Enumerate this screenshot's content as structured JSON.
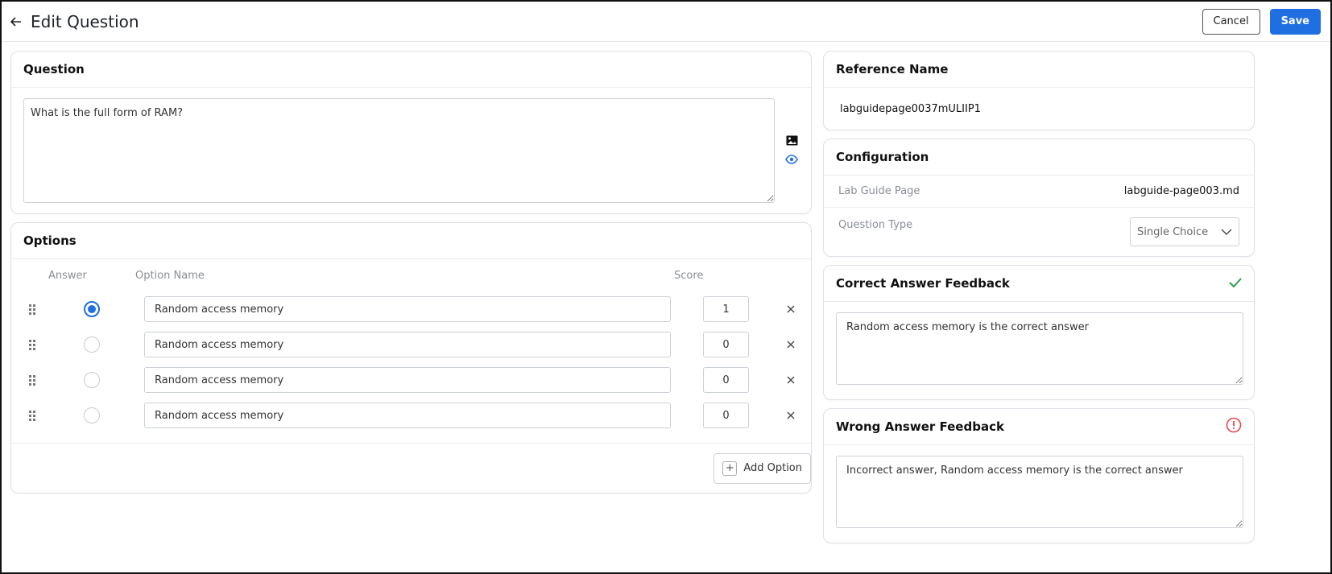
{
  "header": {
    "title": "Edit Question",
    "cancel_label": "Cancel",
    "save_label": "Save"
  },
  "question": {
    "heading": "Question",
    "text": "What is the full form of RAM?"
  },
  "options": {
    "heading": "Options",
    "columns": {
      "answer": "Answer",
      "name": "Option Name",
      "score": "Score"
    },
    "items": [
      {
        "name": "Random access memory",
        "score": "1",
        "selected": true
      },
      {
        "name": "Random access memory",
        "score": "0",
        "selected": false
      },
      {
        "name": "Random access memory",
        "score": "0",
        "selected": false
      },
      {
        "name": "Random access memory",
        "score": "0",
        "selected": false
      }
    ],
    "add_label": "Add Option"
  },
  "reference": {
    "heading": "Reference Name",
    "value": "labguidepage0037mULIIP1"
  },
  "configuration": {
    "heading": "Configuration",
    "lab_guide_label": "Lab Guide Page",
    "lab_guide_value": "labguide-page003.md",
    "question_type_label": "Question Type",
    "question_type_value": "Single Choice"
  },
  "correct_feedback": {
    "heading": "Correct Answer Feedback",
    "text": "Random access memory is the correct answer"
  },
  "wrong_feedback": {
    "heading": "Wrong Answer Feedback",
    "text": "Incorrect answer, Random access memory is the correct answer"
  },
  "colors": {
    "primary": "#1f6fe0",
    "success": "#2e9b4f",
    "danger": "#e5484d"
  },
  "icons": [
    "back-arrow-icon",
    "image-icon",
    "eye-icon",
    "drag-handle-icon",
    "close-icon",
    "plus-icon",
    "chevron-down-icon",
    "check-icon",
    "alert-circle-icon"
  ]
}
